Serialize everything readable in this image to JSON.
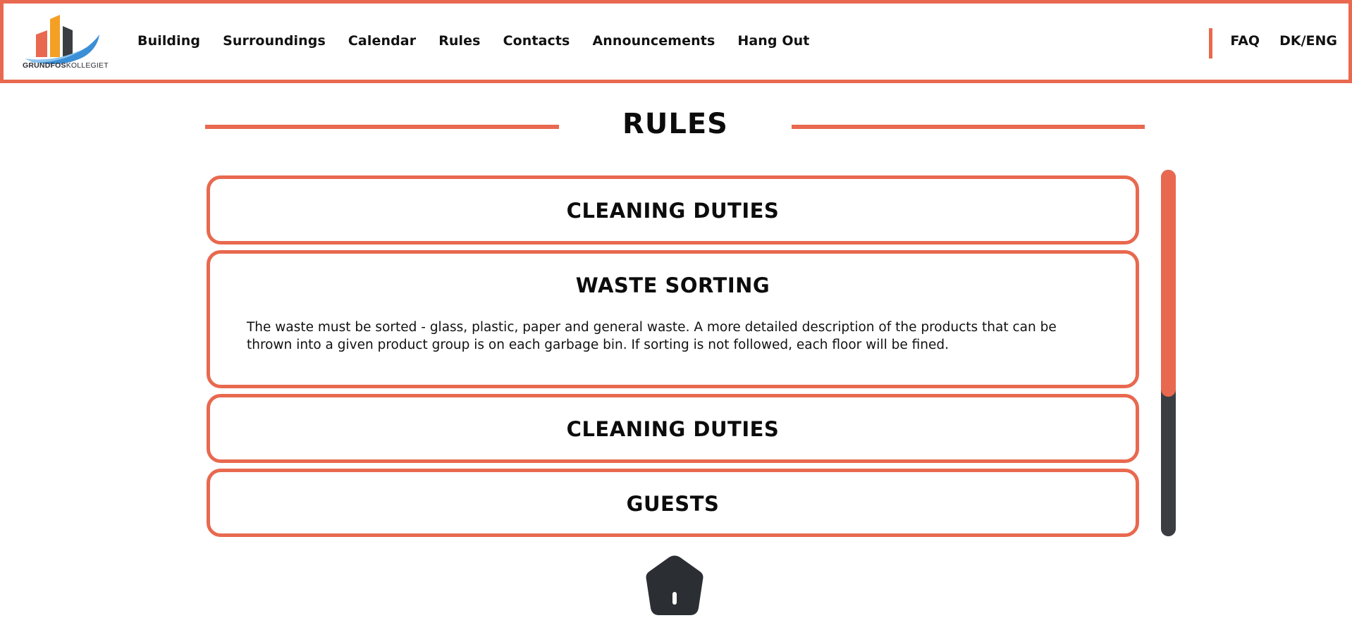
{
  "brand": {
    "logo_text_bold": "GRUNDFOS",
    "logo_text_light": "KOLLEGIET",
    "colors": {
      "accent": "#e8694f",
      "dark": "#3a3d42",
      "orange": "#f4a024",
      "blue": "#3b8fd6"
    }
  },
  "nav": {
    "items": [
      {
        "label": "Building"
      },
      {
        "label": "Surroundings"
      },
      {
        "label": "Calendar"
      },
      {
        "label": "Rules"
      },
      {
        "label": "Contacts"
      },
      {
        "label": "Announcements"
      },
      {
        "label": "Hang Out"
      }
    ],
    "faq": "FAQ",
    "language": "DK/ENG"
  },
  "page": {
    "title": "RULES"
  },
  "rules": [
    {
      "title": "CLEANING DUTIES",
      "expanded": false
    },
    {
      "title": "WASTE SORTING",
      "expanded": true,
      "body": "The waste must be sorted - glass, plastic, paper and general waste. A more detailed description of the products that can be thrown into a given product group is on each garbage bin. If sorting is not followed, each floor will be fined."
    },
    {
      "title": "CLEANING DUTIES",
      "expanded": false
    },
    {
      "title": "GUESTS",
      "expanded": false
    }
  ],
  "scroll": {
    "position_fraction": 0.0,
    "visible_fraction": 0.62
  },
  "icons": {
    "home": "home-icon"
  }
}
